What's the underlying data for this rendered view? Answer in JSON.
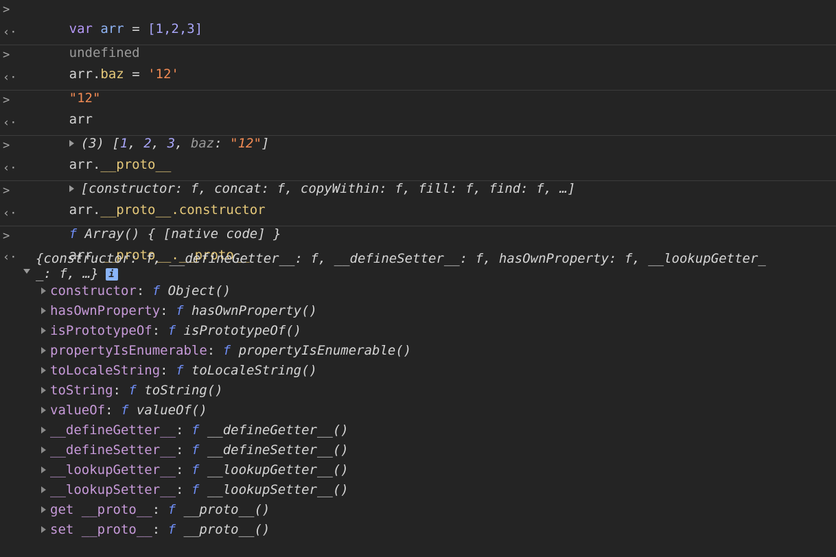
{
  "colors": {
    "background": "#242424",
    "keyword": "#b598f7",
    "number": "#a9a6f9",
    "string": "#f28b54",
    "property": "#c79ad9",
    "function_marker": "#6f8ef6"
  },
  "icons": {
    "input_prompt": "chevron-right-icon",
    "output_prompt": "return-arrow-icon",
    "expand": "triangle-right-icon",
    "expanded": "triangle-down-icon",
    "info": "info-icon"
  },
  "entries": [
    {
      "input": {
        "keyword": "var",
        "name": "arr",
        "eq": "=",
        "value": "[1,2,3]"
      },
      "output": {
        "text": "undefined"
      }
    },
    {
      "input": {
        "obj": "arr.",
        "prop": "baz",
        "eq": "=",
        "value": "'12'"
      },
      "output": {
        "text": "\"12\""
      }
    },
    {
      "input": {
        "text": "arr"
      },
      "output": {
        "count": "(3)",
        "open": "[",
        "n1": "1",
        "n2": "2",
        "n3": "3",
        "key": "baz",
        "val": "\"12\"",
        "close": "]"
      }
    },
    {
      "input": {
        "obj": "arr.",
        "prop": "__proto__"
      },
      "output": {
        "preview": "[constructor: f, concat: f, copyWithin: f, fill: f, find: f, …]"
      }
    },
    {
      "input": {
        "obj": "arr.",
        "prop": "__proto__.constructor"
      },
      "output": {
        "f": "f",
        "text": "Array() { [native code] }"
      }
    },
    {
      "input": {
        "obj": "arr.",
        "prop": "__proto__.__proto__"
      },
      "output": {
        "preview_line1": "{constructor: f, __defineGetter__: f, __defineSetter__: f, hasOwnProperty: f, __lookupGetter_",
        "preview_line2": "_: f, …}",
        "info": "i",
        "properties": [
          {
            "name": "constructor",
            "f": "f",
            "value": "Object()"
          },
          {
            "name": "hasOwnProperty",
            "f": "f",
            "value": "hasOwnProperty()"
          },
          {
            "name": "isPrototypeOf",
            "f": "f",
            "value": "isPrototypeOf()"
          },
          {
            "name": "propertyIsEnumerable",
            "f": "f",
            "value": "propertyIsEnumerable()"
          },
          {
            "name": "toLocaleString",
            "f": "f",
            "value": "toLocaleString()"
          },
          {
            "name": "toString",
            "f": "f",
            "value": "toString()"
          },
          {
            "name": "valueOf",
            "f": "f",
            "value": "valueOf()"
          },
          {
            "name": "__defineGetter__",
            "f": "f",
            "value": "__defineGetter__()"
          },
          {
            "name": "__defineSetter__",
            "f": "f",
            "value": "__defineSetter__()"
          },
          {
            "name": "__lookupGetter__",
            "f": "f",
            "value": "__lookupGetter__()"
          },
          {
            "name": "__lookupSetter__",
            "f": "f",
            "value": "__lookupSetter__()"
          },
          {
            "name": "get __proto__",
            "f": "f",
            "value": "__proto__()"
          },
          {
            "name": "set __proto__",
            "f": "f",
            "value": "__proto__()"
          }
        ]
      }
    }
  ]
}
